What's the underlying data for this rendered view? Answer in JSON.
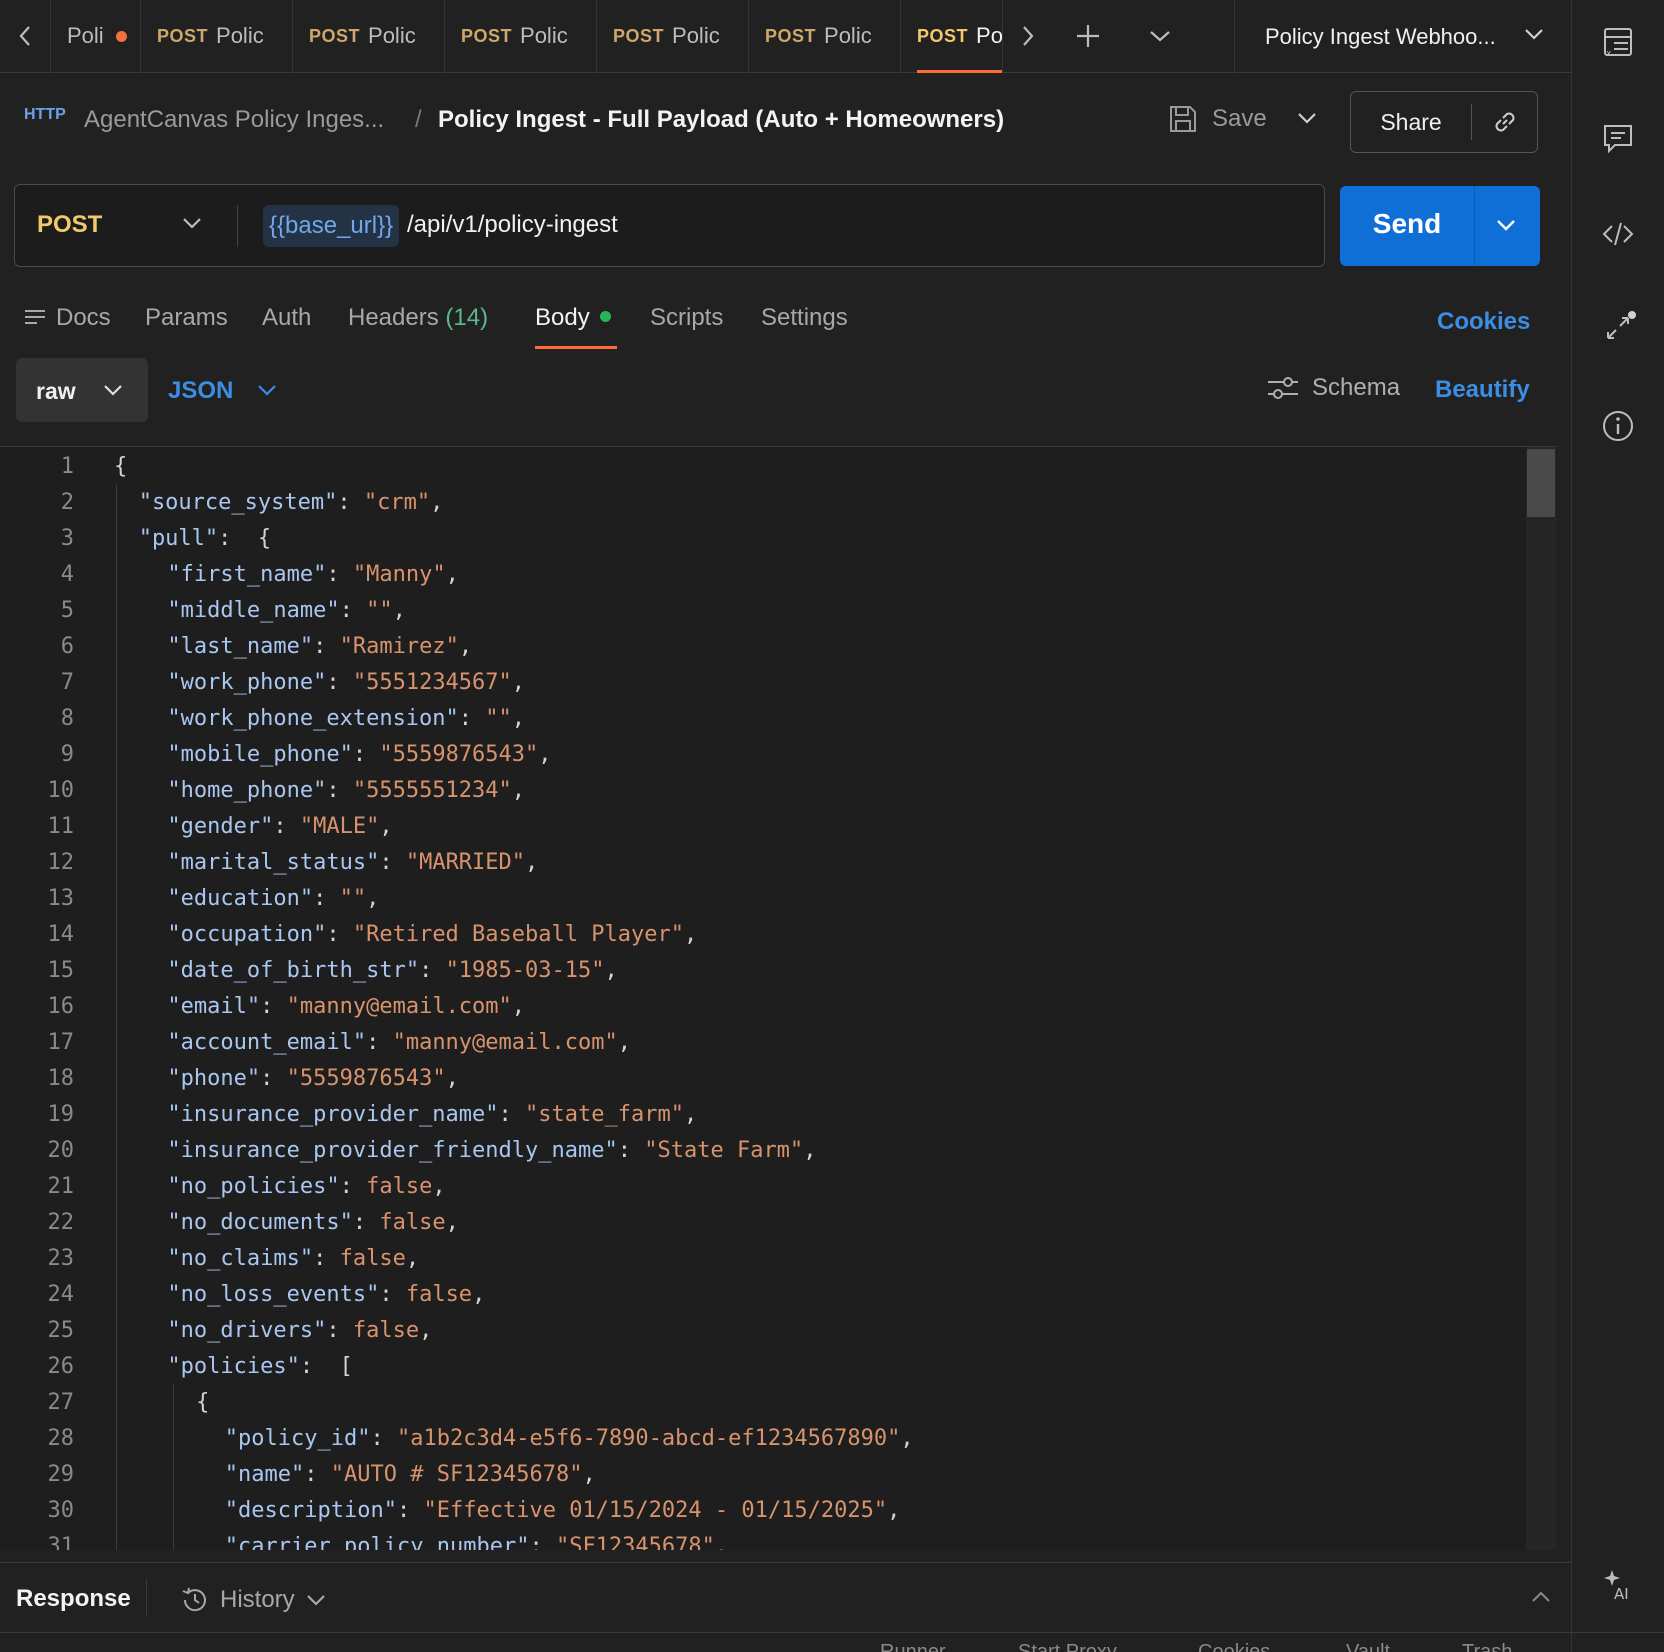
{
  "tabs": [
    {
      "method": "",
      "label": "Poli",
      "unsaved": true
    },
    {
      "method": "POST",
      "label": "Polic"
    },
    {
      "method": "POST",
      "label": "Polic"
    },
    {
      "method": "POST",
      "label": "Polic"
    },
    {
      "method": "POST",
      "label": "Polic"
    },
    {
      "method": "POST",
      "label": "Polic"
    },
    {
      "method": "POST",
      "label": "Po",
      "active": true
    }
  ],
  "environment": "Policy Ingest Webhoo...",
  "breadcrumb": {
    "collection": "AgentCanvas Policy Inges...",
    "separator": "/",
    "request": "Policy Ingest - Full Payload (Auto + Homeowners)",
    "icon_text": "HTTP"
  },
  "toolbar": {
    "save_label": "Save",
    "share_label": "Share"
  },
  "request": {
    "method": "POST",
    "url_variable": "{{base_url}}",
    "url_path": "/api/v1/policy-ingest",
    "send_label": "Send"
  },
  "request_tabs": {
    "docs": "Docs",
    "params": "Params",
    "auth": "Auth",
    "headers": "Headers",
    "headers_count": "(14)",
    "body": "Body",
    "scripts": "Scripts",
    "settings": "Settings",
    "cookies": "Cookies"
  },
  "body_toolbar": {
    "mode": "raw",
    "language": "JSON",
    "schema": "Schema",
    "beautify": "Beautify"
  },
  "editor_lines": [
    {
      "n": "1",
      "indent": 0,
      "text": "{"
    },
    {
      "n": "2",
      "indent": 1,
      "key": "source_system",
      "val": "\"crm\"",
      "tail": ","
    },
    {
      "n": "3",
      "indent": 1,
      "key": "pull",
      "val": "",
      "tail": " {"
    },
    {
      "n": "4",
      "indent": 2,
      "key": "first_name",
      "val": "\"Manny\"",
      "tail": ","
    },
    {
      "n": "5",
      "indent": 2,
      "key": "middle_name",
      "val": "\"\"",
      "tail": ","
    },
    {
      "n": "6",
      "indent": 2,
      "key": "last_name",
      "val": "\"Ramirez\"",
      "tail": ","
    },
    {
      "n": "7",
      "indent": 2,
      "key": "work_phone",
      "val": "\"5551234567\"",
      "tail": ","
    },
    {
      "n": "8",
      "indent": 2,
      "key": "work_phone_extension",
      "val": "\"\"",
      "tail": ","
    },
    {
      "n": "9",
      "indent": 2,
      "key": "mobile_phone",
      "val": "\"5559876543\"",
      "tail": ","
    },
    {
      "n": "10",
      "indent": 2,
      "key": "home_phone",
      "val": "\"5555551234\"",
      "tail": ","
    },
    {
      "n": "11",
      "indent": 2,
      "key": "gender",
      "val": "\"MALE\"",
      "tail": ","
    },
    {
      "n": "12",
      "indent": 2,
      "key": "marital_status",
      "val": "\"MARRIED\"",
      "tail": ","
    },
    {
      "n": "13",
      "indent": 2,
      "key": "education",
      "val": "\"\"",
      "tail": ","
    },
    {
      "n": "14",
      "indent": 2,
      "key": "occupation",
      "val": "\"Retired Baseball Player\"",
      "tail": ","
    },
    {
      "n": "15",
      "indent": 2,
      "key": "date_of_birth_str",
      "val": "\"1985-03-15\"",
      "tail": ","
    },
    {
      "n": "16",
      "indent": 2,
      "key": "email",
      "val": "\"manny@email.com\"",
      "tail": ","
    },
    {
      "n": "17",
      "indent": 2,
      "key": "account_email",
      "val": "\"manny@email.com\"",
      "tail": ","
    },
    {
      "n": "18",
      "indent": 2,
      "key": "phone",
      "val": "\"5559876543\"",
      "tail": ","
    },
    {
      "n": "19",
      "indent": 2,
      "key": "insurance_provider_name",
      "val": "\"state_farm\"",
      "tail": ","
    },
    {
      "n": "20",
      "indent": 2,
      "key": "insurance_provider_friendly_name",
      "val": "\"State Farm\"",
      "tail": ","
    },
    {
      "n": "21",
      "indent": 2,
      "key": "no_policies",
      "val": "false",
      "tail": ","
    },
    {
      "n": "22",
      "indent": 2,
      "key": "no_documents",
      "val": "false",
      "tail": ","
    },
    {
      "n": "23",
      "indent": 2,
      "key": "no_claims",
      "val": "false",
      "tail": ","
    },
    {
      "n": "24",
      "indent": 2,
      "key": "no_loss_events",
      "val": "false",
      "tail": ","
    },
    {
      "n": "25",
      "indent": 2,
      "key": "no_drivers",
      "val": "false",
      "tail": ","
    },
    {
      "n": "26",
      "indent": 2,
      "key": "policies",
      "val": "",
      "tail": " ["
    },
    {
      "n": "27",
      "indent": 3,
      "text": "{"
    },
    {
      "n": "28",
      "indent": 4,
      "key": "policy_id",
      "val": "\"a1b2c3d4-e5f6-7890-abcd-ef1234567890\"",
      "tail": ","
    },
    {
      "n": "29",
      "indent": 4,
      "key": "name",
      "val": "\"AUTO # SF12345678\"",
      "tail": ","
    },
    {
      "n": "30",
      "indent": 4,
      "key": "description",
      "val": "\"Effective 01/15/2024 - 01/15/2025\"",
      "tail": ","
    },
    {
      "n": "31",
      "indent": 4,
      "key": "carrier_policy_number",
      "val": "\"SF12345678\"",
      "tail": ","
    }
  ],
  "response": {
    "title": "Response",
    "history": "History"
  },
  "status_bar": [
    "Runner",
    "Start Proxy",
    "Cookies",
    "Vault",
    "Trash"
  ],
  "colors": {
    "accent": "#ff6c37",
    "send": "#0f6fd6",
    "link": "#3d8de5",
    "method_post": "#f3c86b"
  }
}
